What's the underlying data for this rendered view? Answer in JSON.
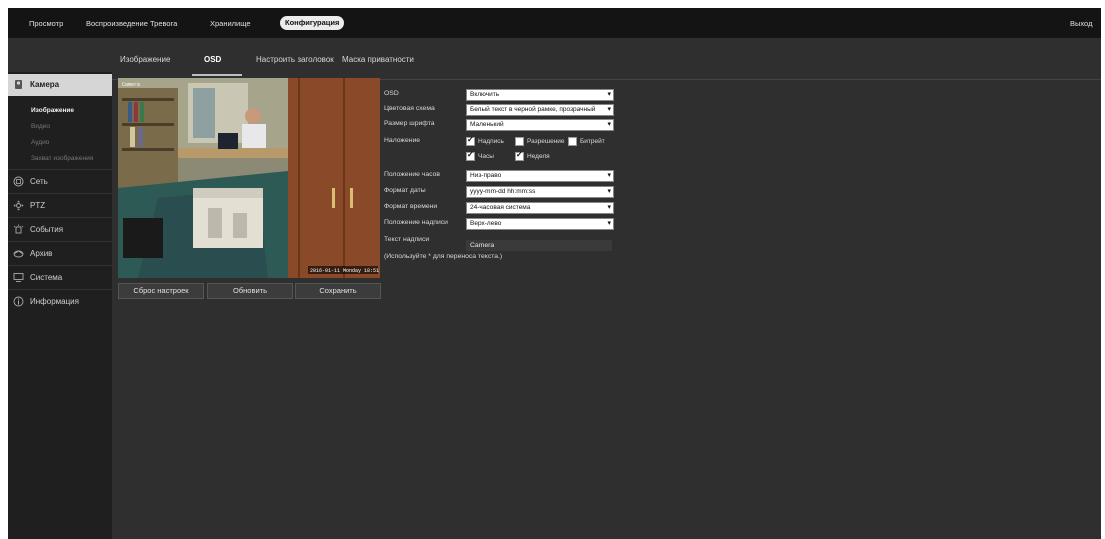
{
  "topnav": {
    "items": [
      {
        "label": "Просмотр"
      },
      {
        "label": "Воспроизведение"
      },
      {
        "label": "Тревога"
      },
      {
        "label": "Хранилище"
      },
      {
        "label": "Конфигурация",
        "active": true
      }
    ],
    "logout": "Выход"
  },
  "subnav": {
    "tabs": [
      {
        "label": "Изображение"
      },
      {
        "label": "OSD",
        "active": true
      },
      {
        "label": "Настроить заголовок"
      },
      {
        "label": "Маска приватности"
      }
    ]
  },
  "sidebar": {
    "sections": [
      {
        "label": "Камера",
        "icon": "camera-icon",
        "active": true
      },
      {
        "label": "Сеть",
        "icon": "network-icon"
      },
      {
        "label": "PTZ",
        "icon": "ptz-icon"
      },
      {
        "label": "События",
        "icon": "events-icon"
      },
      {
        "label": "Архив",
        "icon": "archive-icon"
      },
      {
        "label": "Система",
        "icon": "system-icon"
      },
      {
        "label": "Информация",
        "icon": "info-icon"
      }
    ],
    "camera_sub": [
      {
        "label": "Изображение",
        "active": true
      },
      {
        "label": "Видео"
      },
      {
        "label": "Аудио"
      },
      {
        "label": "Захват изображения"
      }
    ]
  },
  "preview": {
    "overlay_text": "Camera",
    "timestamp": "2016-01-11 Monday 18:51"
  },
  "buttons": {
    "reset": "Сброс настроек",
    "refresh": "Обновить",
    "save": "Сохранить"
  },
  "form": {
    "osd": {
      "label": "OSD",
      "value": "Включить"
    },
    "color_scheme": {
      "label": "Цветовая схема",
      "value": "Белый текст в черной рамке, прозрачный"
    },
    "font_size": {
      "label": "Размер шрифта",
      "value": "Маленький"
    },
    "overlay": {
      "label": "Наложение",
      "options": [
        {
          "label": "Надпись",
          "checked": true
        },
        {
          "label": "Разрешение",
          "checked": false
        },
        {
          "label": "Битрейт",
          "checked": false
        },
        {
          "label": "Часы",
          "checked": true
        },
        {
          "label": "Неделя",
          "checked": true
        }
      ]
    },
    "clock_position": {
      "label": "Положение часов",
      "value": "Низ-право"
    },
    "date_format": {
      "label": "Формат даты",
      "value": "yyyy-mm-dd hh:mm:ss"
    },
    "time_format": {
      "label": "Формат времени",
      "value": "24-часовая система"
    },
    "caption_position": {
      "label": "Положение надписи",
      "value": "Верх-лево"
    },
    "caption_text": {
      "label": "Текст надписи",
      "value": "Camera"
    },
    "hint": "(Используйте * для переноса текста.)"
  }
}
